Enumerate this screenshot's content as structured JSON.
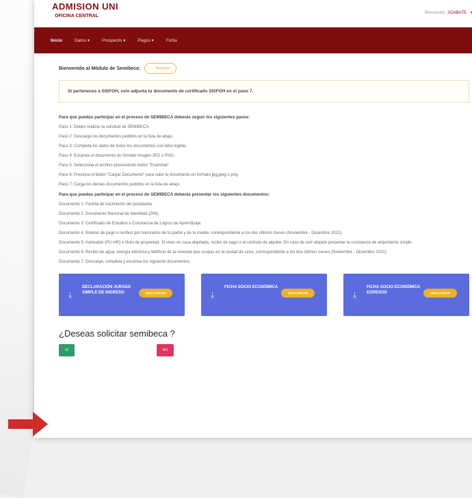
{
  "header": {
    "brand_title": "ADMISION UNI",
    "brand_sub": "OFICINA CENTRAL",
    "welcome_prefix": "Bienvenido, ",
    "welcome_user": "SOABATE"
  },
  "nav": {
    "items": [
      "Inicio",
      "Datos ▾",
      "Prospecto ▾",
      "Pagos ▾",
      "Ficha"
    ]
  },
  "module": {
    "title": "Bienvenido al Módulo de Semibeca:",
    "back_button": "← Regresar",
    "notice": "Si perteneces a SISFOH, solo adjunta tu documento de certificado SISFOH en el paso 7.",
    "steps_title": "Para que puedas participar en el proceso de SEMIBECA deberás seguir los siguientes pasos:",
    "steps": [
      "Paso 1: Debes realizar la solicitud de SEMIBECA.",
      "Paso 2: Descarga los documentos pedidos en la lista de abajo.",
      "Paso 3: Completa los datos de todos los documentos con letra legible.",
      "Paso 4: Escanea el documento en formato imagen JPG o PNG.",
      "Paso 5: Selecciona el archivo presionando botón \"Examinar\"",
      "Paso 6: Presiona el botón \"Cargar Documento\" para subir tu documento en formato jpg,jpeg o png.",
      "Paso 7: Carga los demas documentos pedidos en la lista de abajo."
    ],
    "docs_title": "Para que puedas participar en el proceso de SEMIBECA deberás presentar los siguientes documentos:",
    "documents": [
      "Documento 1: Partida de nacimiento del postulante.",
      "Documento 2: Documento Nacional de Identidad (DNI).",
      "Documento 3: Certificado de Estudios o Constancia de Logros de Aprendizaje.",
      "Documento 4: Boletas de pago o recibos por honorarios de tu padre y de tu madre, correspondiente a los dos últimos meses (Noviembre - Diciembre 2022).",
      "Documento 5: Autovalúo (PU-HR) o título de propiedad. Si vives en casa alquilada, recibo de pago o el contrato de alquiler. En caso de vivir alojado presentar la constancia de alojamiento simple.",
      "Documento 6: Recibo de agua, energía eléctrica y teléfono de la vivienda que ocupas en la ciudad de Lima, correspondiente a los dos últimos meses (Noviembre - Diciembre 2022).",
      "Documento 7: Descarga, completa y escanea los siguiente documentos."
    ],
    "cards": [
      {
        "label": "DECLARACIÓN JURADA SIMPLE DE INGRESO",
        "button": "DESCARGAR"
      },
      {
        "label": "FICHA SOCIO ECONÓMICA",
        "button": "DESCARGAR"
      },
      {
        "label": "FICHA SOCIO ECONÓMICA EGRESOS",
        "button": "DESCARGAR"
      }
    ],
    "question": "¿Deseas solicitar semibeca ?",
    "yes_button": "SÍ",
    "no_button": "NO"
  },
  "colors": {
    "nav_bg": "#800d0d",
    "card_bg": "#5b6cde",
    "download_btn": "#f0b12a",
    "yes_btn": "#2f9b6b",
    "no_btn": "#e1355f",
    "arrow": "#d02a2a"
  },
  "icons": {
    "download": "download-icon",
    "arrow": "arrow-right-icon"
  }
}
